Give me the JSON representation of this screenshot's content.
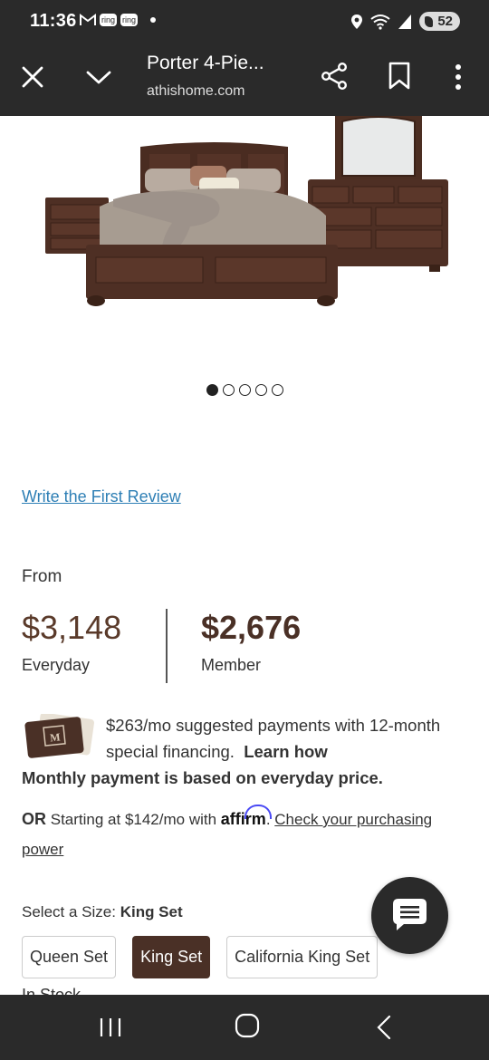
{
  "status_bar": {
    "time": "11:36",
    "ring_labels": [
      "ring",
      "ring"
    ],
    "battery": "52",
    "icons": [
      "gmail-icon",
      "ring-icon",
      "ring-icon",
      "location-icon",
      "wifi-icon",
      "signal-icon",
      "battery-icon"
    ]
  },
  "toolbar": {
    "title": "Porter 4-Pie...",
    "url": "athishome.com",
    "icons": [
      "close-icon",
      "chevron-down-icon",
      "share-icon",
      "bookmark-icon",
      "more-vert-icon"
    ]
  },
  "carousel": {
    "dot_count": 5,
    "active_index": 0
  },
  "review": {
    "link": "Write the First Review"
  },
  "pricing": {
    "from_label": "From",
    "everyday_price": "$3,148",
    "everyday_label": "Everyday",
    "member_price": "$2,676",
    "member_label": "Member"
  },
  "financing": {
    "text": "$263/mo suggested payments with 12-month special financing.",
    "learn_how": "Learn how",
    "monthly_note": "Monthly payment is based on everyday price.",
    "or_label": "OR",
    "affirm_text": "Starting at $142/mo with",
    "affirm_brand": "affirm",
    "check_link": "Check your purchasing power"
  },
  "size": {
    "label": "Select a Size:",
    "selected": "King Set",
    "options": [
      "Queen Set",
      "King Set",
      "California King Set"
    ],
    "peek_text": "In Stock"
  },
  "colors": {
    "brand_brown": "#4a3026",
    "link_blue": "#2e7fb5",
    "chrome_dark": "#2a2a2a"
  }
}
